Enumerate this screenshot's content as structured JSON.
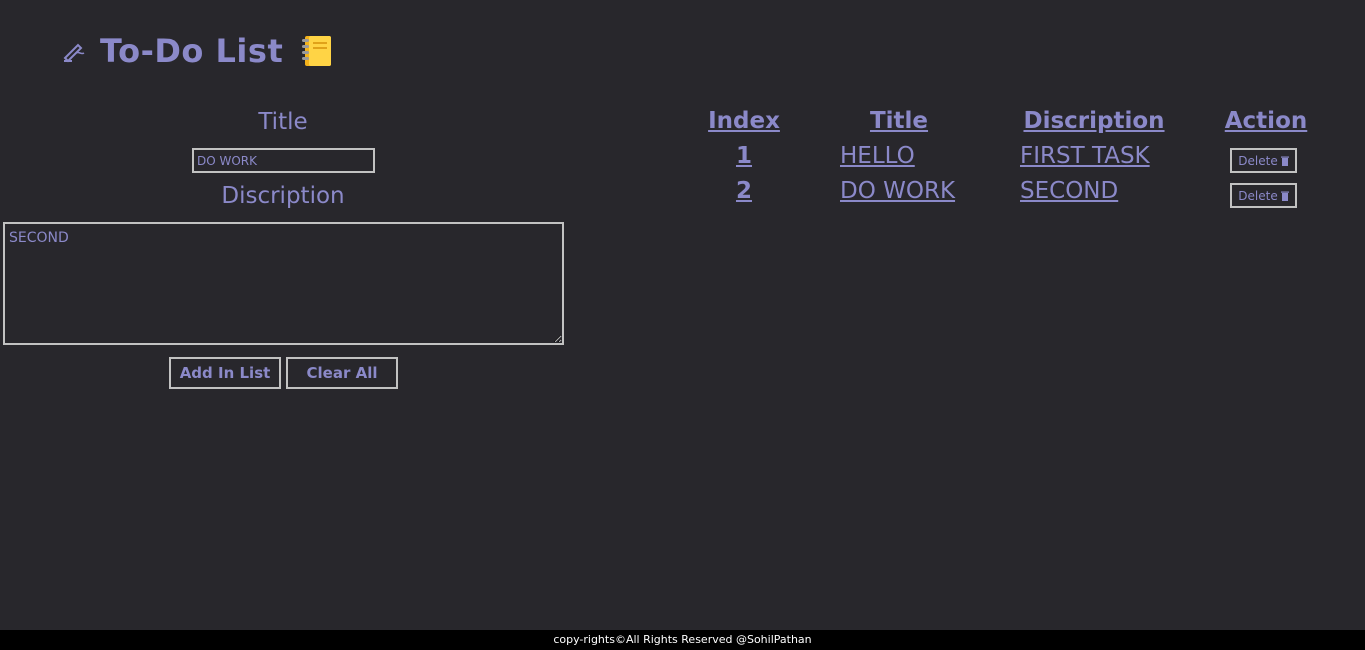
{
  "header": {
    "title": "To-Do List",
    "pen_icon": "writing-hand-icon",
    "notebook_icon": "notebook-icon"
  },
  "form": {
    "title_label": "Title",
    "title_value": "DO WORK",
    "description_label": "Discription",
    "description_value": "SECOND",
    "add_button": "Add In List",
    "clear_button": "Clear All"
  },
  "table": {
    "headers": [
      "Index",
      "Title",
      "Discription",
      "Action"
    ],
    "rows": [
      {
        "index": "1",
        "title": "HELLO",
        "description": "FIRST TASK",
        "action": "Delete"
      },
      {
        "index": "2",
        "title": "DO WORK",
        "description": "SECOND",
        "action": "Delete"
      }
    ]
  },
  "footer": {
    "text": "copy-rights©All Rights Reserved @SohilPathan"
  },
  "colors": {
    "background": "#28272c",
    "text": "#8b89c9",
    "border": "#c2c2c2",
    "footer_bg": "#000000",
    "footer_text": "#ffffff"
  }
}
